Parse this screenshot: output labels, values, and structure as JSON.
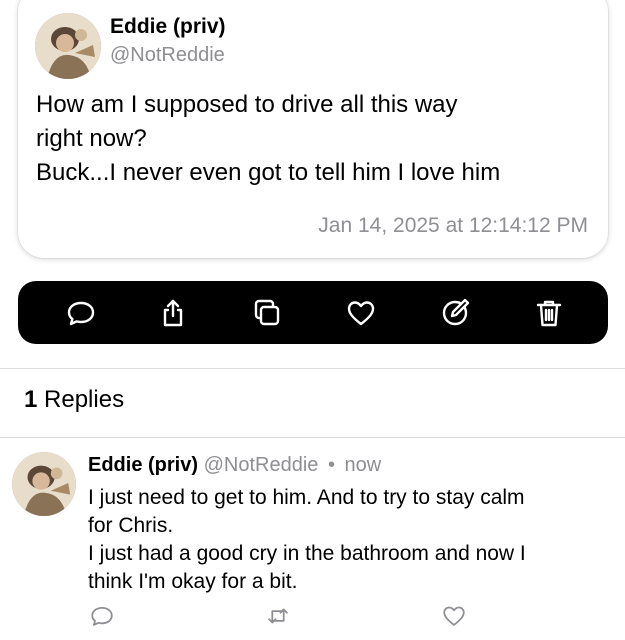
{
  "post": {
    "display_name": "Eddie (priv)",
    "handle": "@NotReddie",
    "body_lines": [
      "How am I supposed to drive all this way",
      "right now?",
      "Buck...I never even got to tell him I love him"
    ],
    "timestamp": "Jan 14, 2025 at 12:14:12 PM"
  },
  "action_bar": {
    "background": "#000000",
    "icon_color": "#ffffff",
    "icons": [
      "reply-icon",
      "share-icon",
      "copy-icon",
      "like-icon",
      "edit-icon",
      "delete-icon"
    ]
  },
  "replies": {
    "count": "1",
    "label": "Replies"
  },
  "reply": {
    "display_name": "Eddie (priv)",
    "handle": "@NotReddie",
    "separator": "•",
    "time": "now",
    "body_lines": [
      "I just need to get to him. And to try to stay calm",
      "for Chris.",
      "I just had a good cry in the bathroom and now I",
      "think I'm okay for a bit."
    ],
    "icons": [
      "reply-icon",
      "repost-icon",
      "like-icon"
    ]
  },
  "colors": {
    "secondary_text": "#8e8e93",
    "divider": "#dcdcdc"
  }
}
